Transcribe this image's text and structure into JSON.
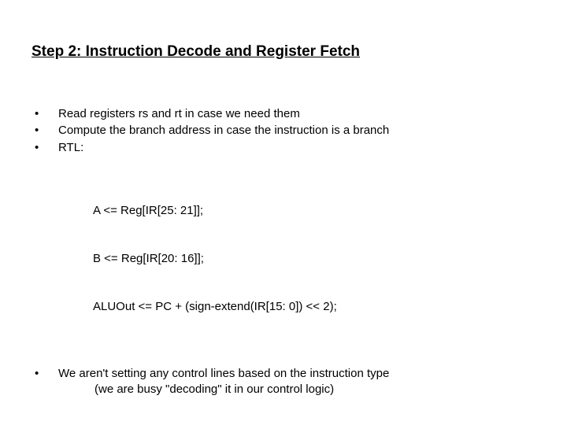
{
  "title": "Step 2:  Instruction Decode and Register Fetch",
  "bullet_mark": "•",
  "bullets_a": [
    "Read registers rs and rt in case we need them",
    "Compute the branch address in case the instruction is a branch",
    "RTL:"
  ],
  "rtl": [
    "A <= Reg[IR[25: 21]];",
    "B <= Reg[IR[20: 16]];",
    "ALUOut <= PC + (sign-extend(IR[15: 0]) << 2);"
  ],
  "bullets_b": {
    "main": "We aren't setting any control lines based on the instruction type",
    "sub": "(we are busy \"decoding\" it in our control logic)"
  }
}
